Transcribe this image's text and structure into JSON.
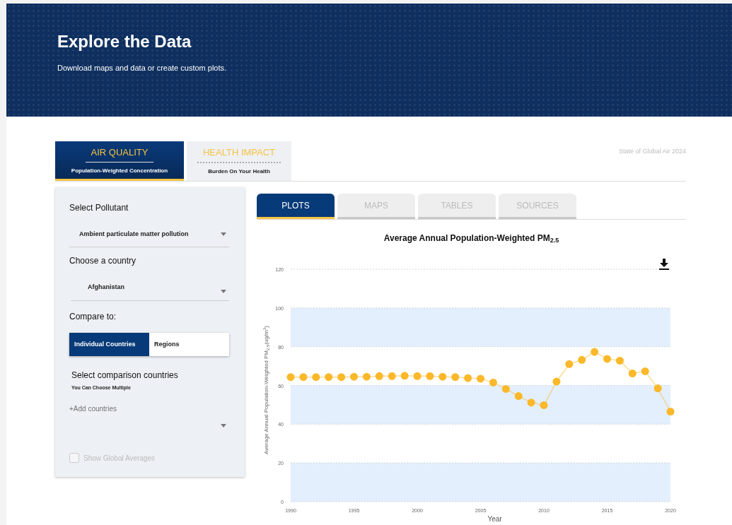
{
  "header": {
    "title": "Explore the Data",
    "subtitle": "Download maps and data or create custom plots."
  },
  "top_tabs": [
    {
      "title": "AIR QUALITY",
      "subtitle": "Population-Weighted Concentration",
      "selected": true
    },
    {
      "title": "HEALTH IMPACT",
      "subtitle": "Burden On Your Health",
      "selected": false
    }
  ],
  "edition": "State of Global Air 2024",
  "controls": {
    "pollutant_label": "Select Pollutant",
    "pollutant": "Ambient particulate matter pollution",
    "country_label": "Choose a country",
    "country": "Afghanistan",
    "compare_label": "Compare to:",
    "compare_options": [
      {
        "label": "Individual Countries",
        "selected": true
      },
      {
        "label": "Regions",
        "selected": false
      }
    ],
    "comparison_label": "Select comparison countries",
    "comparison_hint": "You Can Choose Multiple",
    "add_placeholder": "+Add countries",
    "global_averages": {
      "label": "Show Global Averages",
      "checked": false,
      "disabled": true
    }
  },
  "view_tabs": [
    {
      "label": "PLOTS",
      "selected": true
    },
    {
      "label": "MAPS",
      "selected": false
    },
    {
      "label": "TABLES",
      "selected": false
    },
    {
      "label": "SOURCES",
      "selected": false
    }
  ],
  "chart": {
    "title": "Average Annual Population-Weighted PM$_{2.5}$",
    "chart_data": {
      "type": "line",
      "xlabel": "Year",
      "ylabel": "Average Annual Population-Weighted PM$_{2.5}$(ug/m$^{3}$)",
      "x": [
        1990,
        1991,
        1992,
        1993,
        1994,
        1995,
        1996,
        1997,
        1998,
        1999,
        2000,
        2001,
        2002,
        2003,
        2004,
        2005,
        2006,
        2007,
        2008,
        2009,
        2010,
        2011,
        2012,
        2013,
        2014,
        2015,
        2016,
        2017,
        2018,
        2019,
        2020
      ],
      "grid": true,
      "series": [
        {
          "color": "#fbb829",
          "marker": "circle",
          "values": [
            64.3,
            64.3,
            64.3,
            64.3,
            64.3,
            64.5,
            64.5,
            64.8,
            64.8,
            65,
            64.8,
            64.8,
            64.5,
            64.3,
            63.8,
            63.5,
            61.5,
            58.2,
            54.5,
            51.2,
            49.8,
            62,
            71,
            73.2,
            77.3,
            73.7,
            72.8,
            66.2,
            67.3,
            58.5,
            46.5
          ]
        }
      ],
      "xlim": [
        1990,
        2020
      ],
      "ylim": [
        0,
        120
      ],
      "xticks": [
        1990,
        1995,
        2000,
        2005,
        2010,
        2015,
        2020
      ],
      "yticks": [
        0,
        20,
        40,
        60,
        80,
        100,
        120
      ]
    }
  }
}
